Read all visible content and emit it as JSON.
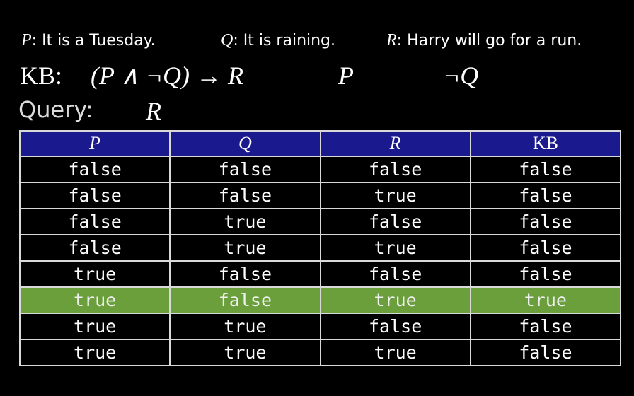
{
  "propositions": [
    {
      "symbol": "P",
      "text": ": It is a Tuesday."
    },
    {
      "symbol": "Q",
      "text": ": It is raining."
    },
    {
      "symbol": "R",
      "text": ": Harry will go for a run."
    }
  ],
  "kb": {
    "label": "KB:",
    "sentences": [
      "(P ∧ ¬Q) → R",
      "P",
      "¬Q"
    ]
  },
  "query": {
    "label": "Query:",
    "symbol": "R"
  },
  "table": {
    "headers": [
      "P",
      "Q",
      "R",
      "KB"
    ],
    "rows": [
      [
        "false",
        "false",
        "false",
        "false"
      ],
      [
        "false",
        "false",
        "true",
        "false"
      ],
      [
        "false",
        "true",
        "false",
        "false"
      ],
      [
        "false",
        "true",
        "true",
        "false"
      ],
      [
        "true",
        "false",
        "false",
        "false"
      ],
      [
        "true",
        "false",
        "true",
        "true"
      ],
      [
        "true",
        "true",
        "false",
        "false"
      ],
      [
        "true",
        "true",
        "true",
        "false"
      ]
    ],
    "highlighted_row": 5
  },
  "colors": {
    "background": "#000000",
    "header": "#1a1a8e",
    "highlight": "#6a9f3b",
    "text": "#ffffff"
  }
}
